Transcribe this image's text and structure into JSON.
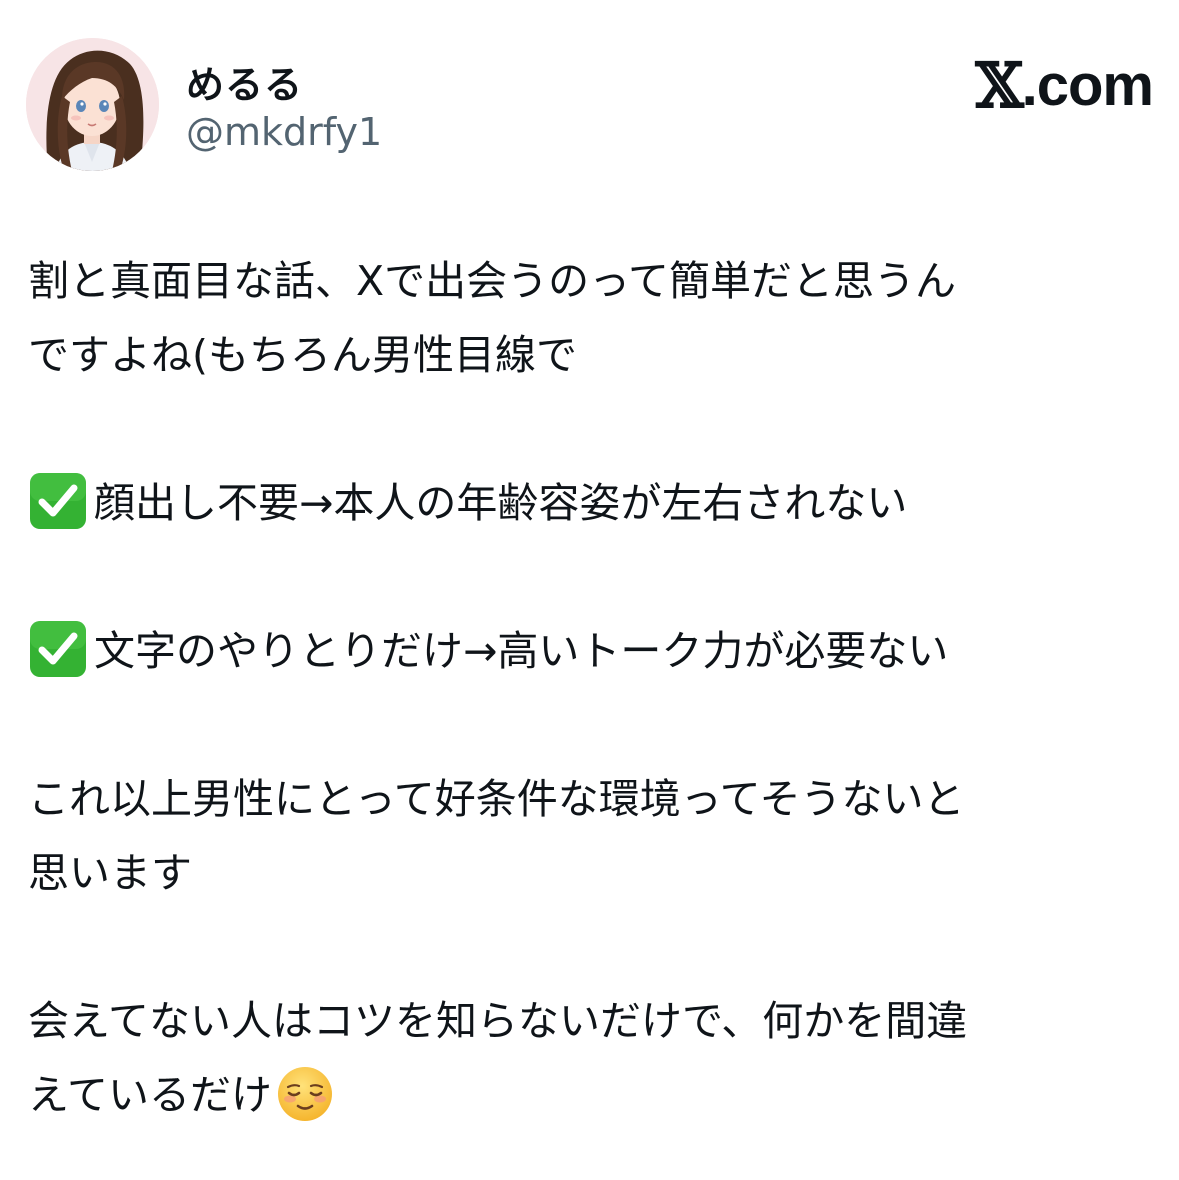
{
  "author": {
    "display_name": "めるる",
    "handle": "@mkdrfy1",
    "avatar_icon": "profile-avatar-anime-girl"
  },
  "brand": {
    "logo_icon": "x-logo-icon",
    "logo_glyph": "𝕏",
    "domain": ".com"
  },
  "post": {
    "line1": "割と真面目な話、Xで出会うのって簡単だと思うん",
    "line2": "ですよね(もちろん男性目線で",
    "point1": "顔出し不要→本人の年齢容姿が左右されない",
    "point2": "文字のやりとりだけ→高いトーク力が必要ない",
    "line3": "これ以上男性にとって好条件な環境ってそうないと",
    "line4": "思います",
    "line5": "会えてない人はコツを知らないだけで、何かを間違",
    "line6": "えているだけ",
    "check_icon": "check-mark-button-icon",
    "ending_emoji": "relieved-face-icon"
  },
  "colors": {
    "text": "#0f1419",
    "handle": "#536471",
    "check_green": "#34b233",
    "emoji_yellow": "#f9c440"
  }
}
